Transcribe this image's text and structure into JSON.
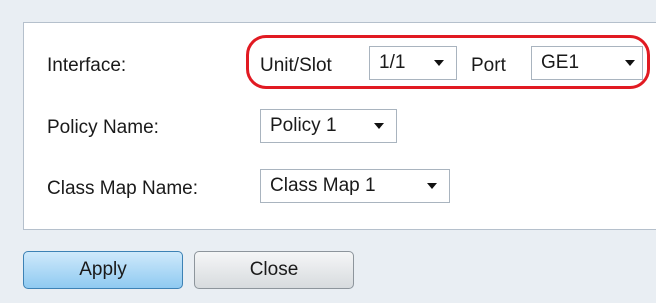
{
  "form": {
    "interface_label": "Interface:",
    "unit_slot_label": "Unit/Slot",
    "unit_slot_value": "1/1",
    "port_label": "Port",
    "port_value": "GE1",
    "policy_name_label": "Policy Name:",
    "policy_name_value": "Policy 1",
    "class_map_name_label": "Class Map Name:",
    "class_map_name_value": "Class Map 1"
  },
  "buttons": {
    "apply_label": "Apply",
    "close_label": "Close"
  },
  "colors": {
    "highlight": "#e11a22",
    "apply_button": "#8fcaf1",
    "background": "#e9eef3"
  }
}
